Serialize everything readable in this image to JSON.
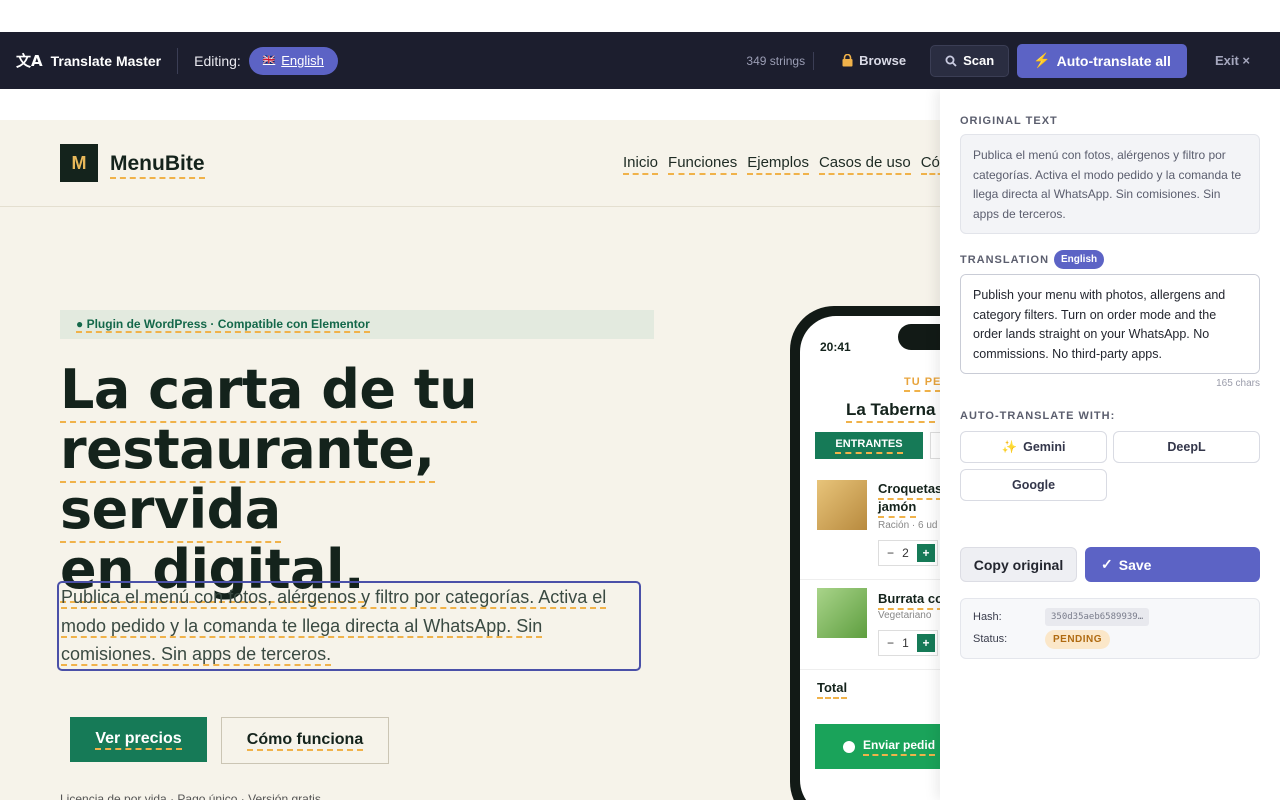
{
  "toolbar": {
    "brand": "Translate Master",
    "brand_icon": "translate-icon",
    "editing_label": "Editing:",
    "language": "English",
    "flag": "🇬🇧",
    "string_count": "349 strings",
    "browse_label": "Browse",
    "scan_label": "Scan",
    "auto_translate_label": "Auto-translate all",
    "exit_label": "Exit ×"
  },
  "site": {
    "logo_letter": "M",
    "logo_text": "MenuBite",
    "nav": [
      "Inicio",
      "Funciones",
      "Ejemplos",
      "Casos de uso",
      "Cóm"
    ],
    "badge": "● Plugin de WordPress · Compatible con Elementor",
    "hero_lines": [
      "La carta de tu",
      "restaurante, servida",
      "en digital."
    ],
    "lead_lines": [
      "Publica el menú con fotos, alérgenos y filtro por categorías. Activa el",
      "modo pedido y la comanda te llega directa al WhatsApp. Sin",
      "comisiones. Sin apps de terceros."
    ],
    "primary_button": "Ver precios",
    "secondary_button": "Cómo funciona",
    "footnote": "Licencia de por vida · Pago único · Versión gratis"
  },
  "phone": {
    "time": "20:41",
    "eyebrow": "TU PE",
    "restaurant": "La Taberna",
    "tab_active": "ENTRANTES",
    "items": [
      {
        "name_lines": [
          "Croquetas",
          "jamón"
        ],
        "desc": "Ración · 6 ud",
        "qty": "2"
      },
      {
        "name_lines": [
          "Burrata co"
        ],
        "desc": "Vegetariano",
        "qty": "1"
      }
    ],
    "total_label": "Total",
    "send_label": "Enviar pedid"
  },
  "panel": {
    "original_label": "ORIGINAL TEXT",
    "original_text": "Publica el menú con fotos, alérgenos y filtro por categorías. Activa el modo pedido y la comanda te llega directa al WhatsApp. Sin comisiones. Sin apps de terceros.",
    "translation_label": "TRANSLATION",
    "translation_badge": "English",
    "translation_text": "Publish your menu with photos, allergens and category filters. Turn on order mode and the order lands straight on your WhatsApp. No commissions. No third-party apps.",
    "char_count": "165 chars",
    "auto_label": "AUTO-TRANSLATE WITH:",
    "providers": {
      "gemini": "Gemini",
      "deepl": "DeepL",
      "google": "Google"
    },
    "copy_label": "Copy original",
    "save_label": "Save",
    "hash_label": "Hash:",
    "hash_value": "350d35aeb6589939…",
    "status_label": "Status:",
    "status_value": "PENDING"
  },
  "colors": {
    "toolbar_bg": "#1c1e2e",
    "accent": "#5c63c5",
    "site_bg": "#f6f3ea",
    "brand_green": "#167a57",
    "dash": "#f0b24a",
    "pending_bg": "#fbe7c9"
  }
}
